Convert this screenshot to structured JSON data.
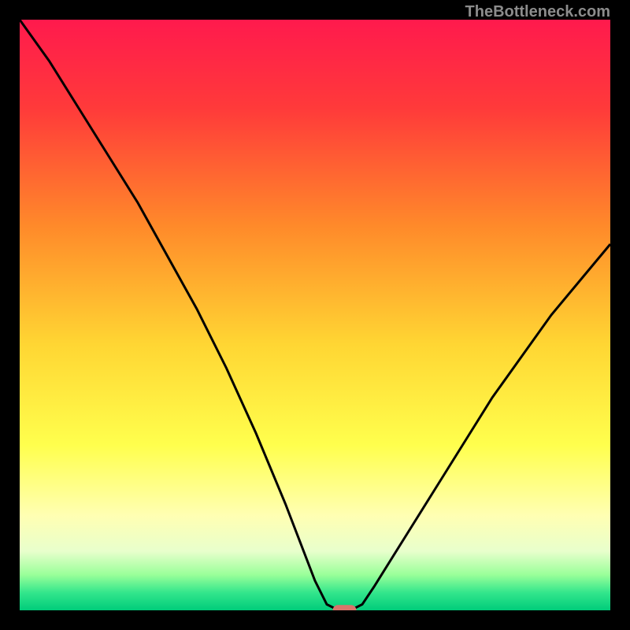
{
  "watermark": "TheBottleneck.com",
  "chart_data": {
    "type": "line",
    "title": "",
    "xlabel": "",
    "ylabel": "",
    "xlim": [
      0,
      100
    ],
    "ylim": [
      0,
      100
    ],
    "background_gradient": {
      "type": "vertical",
      "stops": [
        {
          "offset": 0,
          "color": "#ff1a4d"
        },
        {
          "offset": 15,
          "color": "#ff3a3a"
        },
        {
          "offset": 35,
          "color": "#ff8a2a"
        },
        {
          "offset": 55,
          "color": "#ffd633"
        },
        {
          "offset": 72,
          "color": "#ffff4d"
        },
        {
          "offset": 84,
          "color": "#ffffb3"
        },
        {
          "offset": 90,
          "color": "#e8ffcc"
        },
        {
          "offset": 94,
          "color": "#99ff99"
        },
        {
          "offset": 97,
          "color": "#33e68c"
        },
        {
          "offset": 100,
          "color": "#00cc7a"
        }
      ]
    },
    "series": [
      {
        "name": "bottleneck-curve",
        "color": "#000000",
        "x": [
          0,
          5,
          10,
          15,
          20,
          25,
          30,
          35,
          40,
          45,
          50,
          52,
          54,
          56,
          58,
          60,
          65,
          70,
          75,
          80,
          85,
          90,
          95,
          100
        ],
        "values": [
          100,
          93,
          85,
          77,
          69,
          60,
          51,
          41,
          30,
          18,
          5,
          1,
          0,
          0,
          1,
          4,
          12,
          20,
          28,
          36,
          43,
          50,
          56,
          62
        ]
      }
    ],
    "marker": {
      "name": "optimal-point",
      "shape": "pill",
      "color": "#d9756b",
      "x": 55,
      "y": 0,
      "width_pct": 4,
      "height_pct": 1.8
    }
  }
}
